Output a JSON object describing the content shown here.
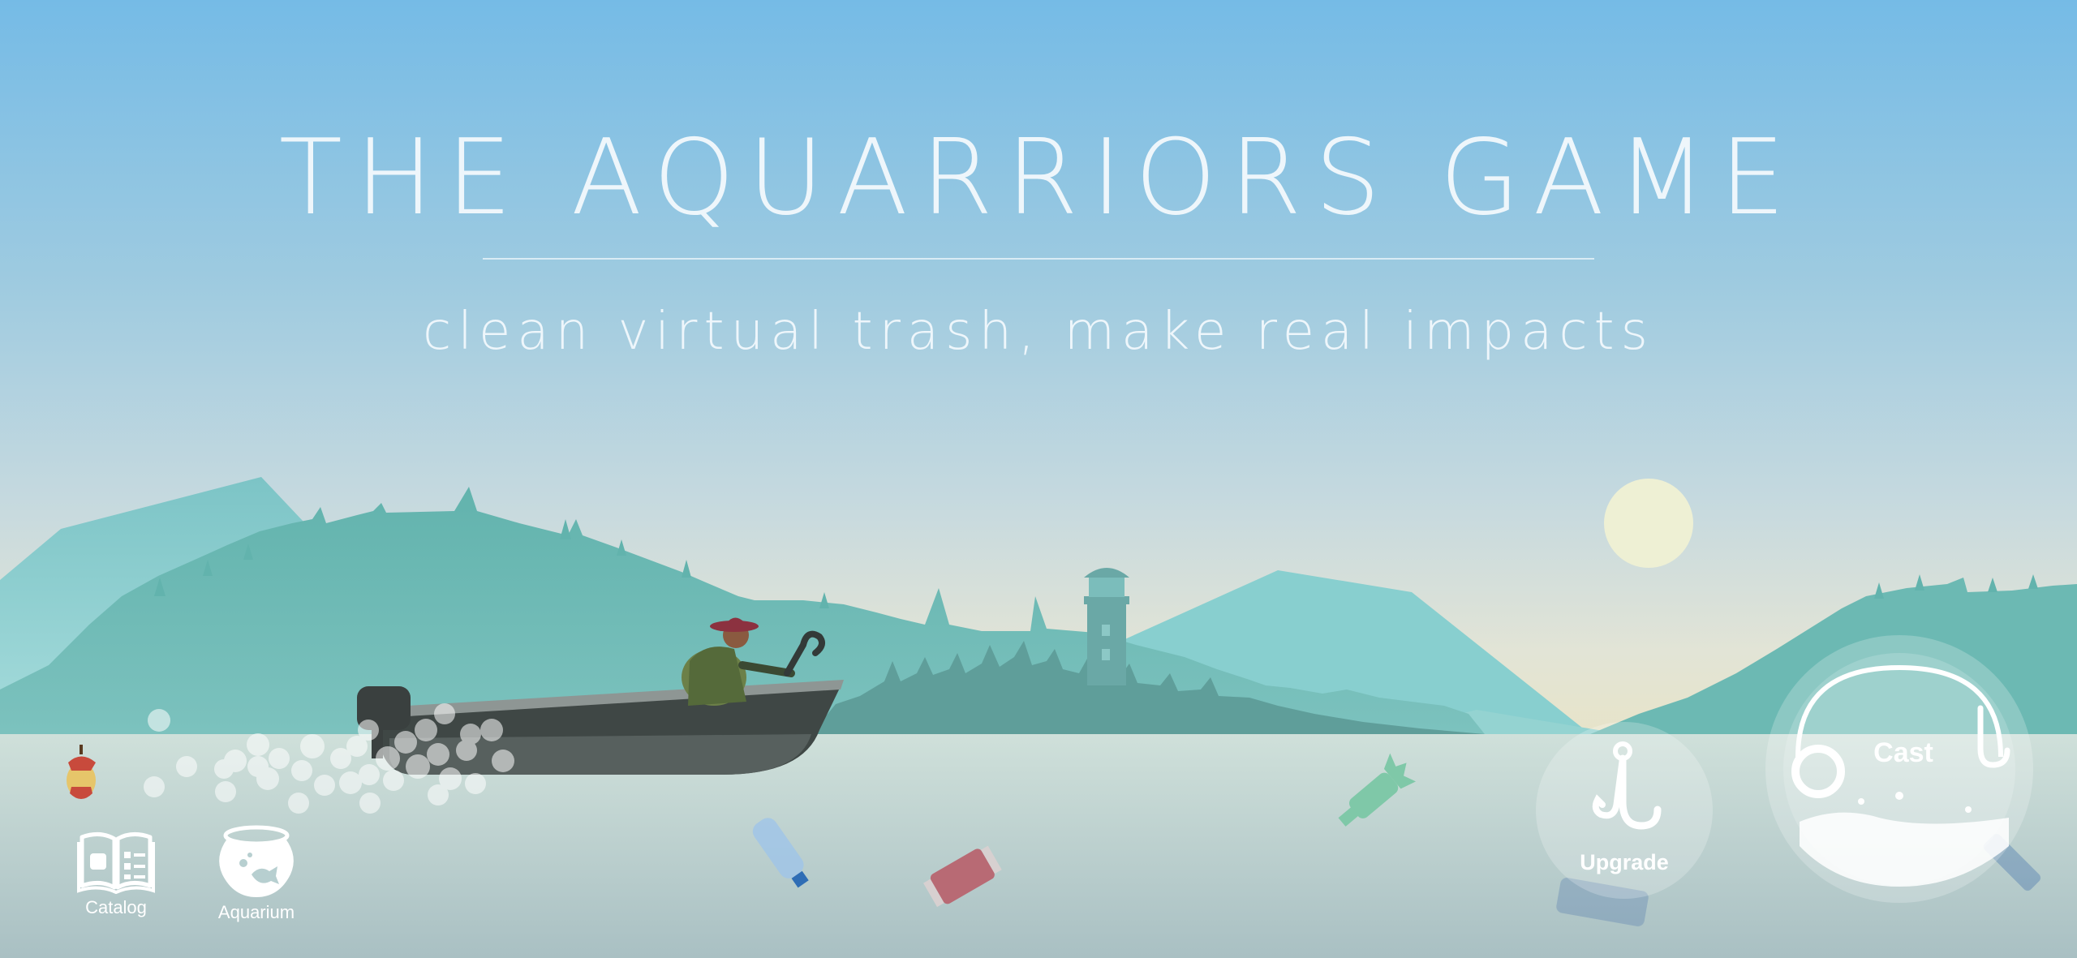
{
  "header": {
    "title": "THE AQUARRIORS GAME",
    "tagline": "clean virtual trash, make real impacts"
  },
  "hud": {
    "catalog_label": "Catalog",
    "aquarium_label": "Aquarium",
    "upgrade_label": "Upgrade",
    "cast_label": "Cast"
  },
  "icons": {
    "catalog": "open-book-icon",
    "aquarium": "fishbowl-icon",
    "upgrade": "fishing-hook-icon",
    "cast": "fishing-line-icon"
  },
  "colors": {
    "sky_top": "#75bbe6",
    "water": "#c9d9d6",
    "mountains": "#6cbab6",
    "sun": "#eef0d4",
    "ui_white": "#ffffff"
  }
}
